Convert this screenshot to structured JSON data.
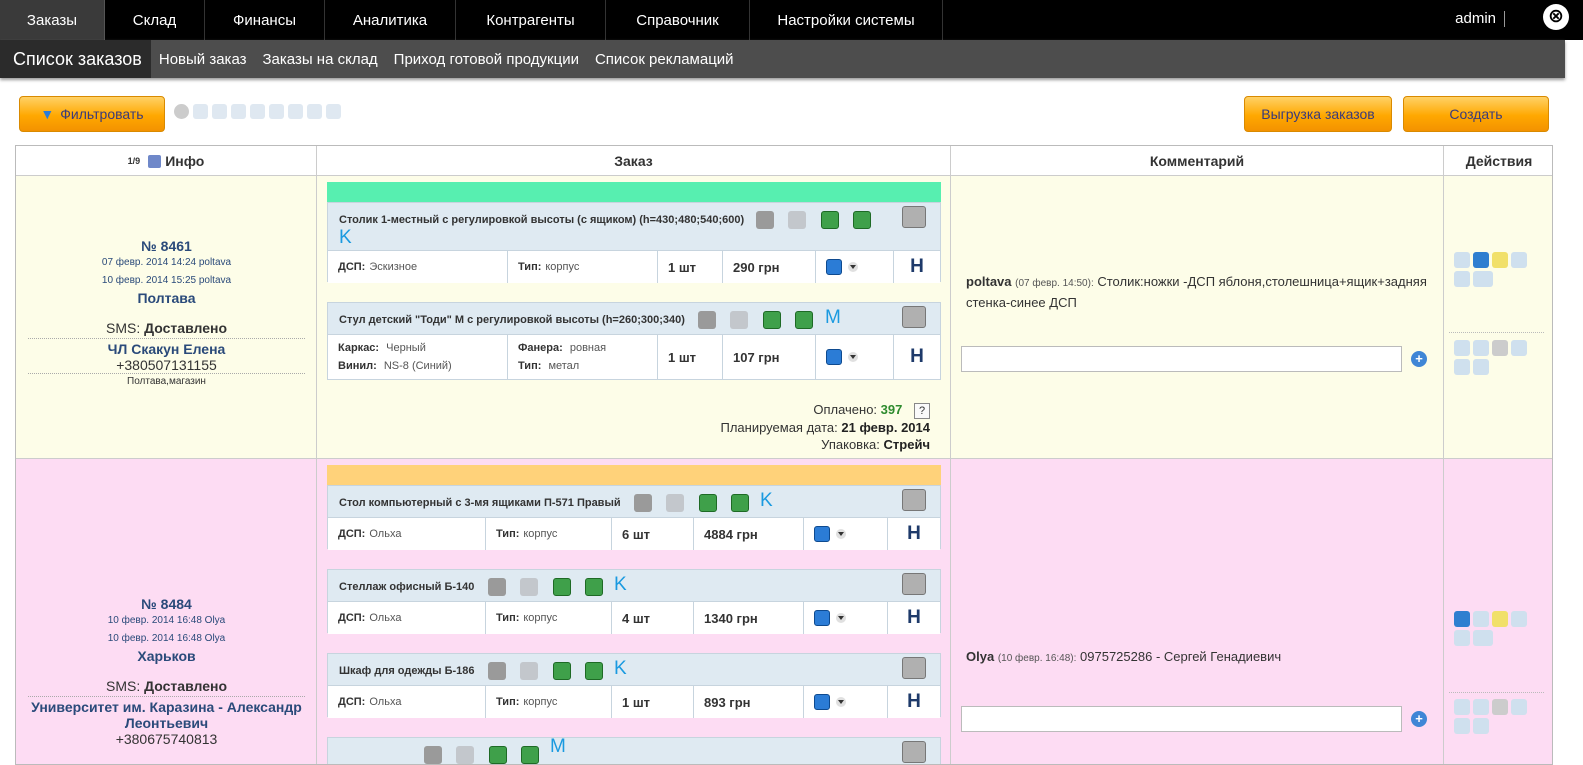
{
  "topnav": {
    "items": [
      "Заказы",
      "Склад",
      "Финансы",
      "Аналитика",
      "Контрагенты",
      "Справочник",
      "Настройки системы"
    ],
    "user": "admin",
    "close_icon": "⊗"
  },
  "subnav": {
    "items": [
      "Список заказов",
      "Новый заказ",
      "Заказы на склад",
      "Приход готовой продукции",
      "Список рекламаций"
    ]
  },
  "toolbar": {
    "filter_label": "Фильтровать",
    "export_label": "Выгрузка заказов",
    "create_label": "Создать"
  },
  "table": {
    "headers": {
      "info": "Инфо",
      "order": "Заказ",
      "comment": "Комментарий",
      "actions": "Действия"
    },
    "sort_icon_label": "1/9"
  },
  "orders": [
    {
      "number": "№ 8461",
      "created": "07 февр. 2014 14:24 poltava",
      "updated": "10 февр. 2014 15:25 poltava",
      "city": "Полтава",
      "sms_label": "SMS:",
      "sms_status": "Доставлено",
      "customer": "ЧЛ Скакун Елена",
      "phone": "+380507131155",
      "note": "Полтава,магазин",
      "status_color": "#57efb0",
      "row_color": "#fdfde8",
      "items": [
        {
          "title": "Столик 1-местный с регулировкой высоты (с ящиком) (h=430;480;540;600)",
          "letter": "K",
          "props": [
            {
              "k": "ДСП:",
              "v": "Эскизное"
            },
            {
              "k": "Тип:",
              "v": "корпус"
            }
          ],
          "qty": "1 шт",
          "price": "290 грн",
          "h": "Н"
        },
        {
          "title": "Стул детский \"Тоди\" М с регулировкой высоты (h=260;300;340)",
          "letter": "M",
          "props": [
            {
              "k": "Каркас:",
              "v": "Черный"
            },
            {
              "k": "Винил:",
              "v": "NS-8 (Синий)"
            },
            {
              "k": "Фанера:",
              "v": "ровная"
            },
            {
              "k": "Тип:",
              "v": "метал"
            }
          ],
          "qty": "1 шт",
          "price": "107 грн",
          "h": "Н"
        }
      ],
      "paid_label": "Оплачено:",
      "paid_value": "397",
      "paid_help": "?",
      "planned_label": "Планируемая дата:",
      "planned_value": "21 февр. 2014",
      "pack_label": "Упаковка:",
      "pack_value": "Стрейч",
      "comment_author": "poltava",
      "comment_time": "(07 февр. 14:50):",
      "comment_text": "Столик:ножки -ДСП яблоня,столешница+ящик+задняя стенка-синее ДСП"
    },
    {
      "number": "№ 8484",
      "created": "10 февр. 2014 16:48 Olya",
      "updated": "10 февр. 2014 16:48 Olya",
      "city": "Харьков",
      "sms_label": "SMS:",
      "sms_status": "Доставлено",
      "customer": "Университет им. Каразина - Александр Леонтьевич",
      "phone": "+380675740813",
      "status_color": "#ffd27a",
      "row_color": "#fddcf3",
      "items": [
        {
          "title": "Стол компьютерный с 3-мя ящиками П-571 Правый",
          "letter": "K",
          "props": [
            {
              "k": "ДСП:",
              "v": "Ольха"
            },
            {
              "k": "Тип:",
              "v": "корпус"
            }
          ],
          "qty": "6 шт",
          "price": "4884 грн",
          "h": "Н"
        },
        {
          "title": "Стеллаж офисный Б-140",
          "letter": "K",
          "props": [
            {
              "k": "ДСП:",
              "v": "Ольха"
            },
            {
              "k": "Тип:",
              "v": "корпус"
            }
          ],
          "qty": "4 шт",
          "price": "1340 грн",
          "h": "Н"
        },
        {
          "title": "Шкаф для одежды Б-186",
          "letter": "K",
          "props": [
            {
              "k": "ДСП:",
              "v": "Ольха"
            },
            {
              "k": "Тип:",
              "v": "корпус"
            }
          ],
          "qty": "1 шт",
          "price": "893 грн",
          "h": "Н"
        },
        {
          "letter": "M"
        }
      ],
      "comment_author": "Olya",
      "comment_time": "(10 февр. 16:48):",
      "comment_text": "0975725286 - Сергей Генадиевич"
    }
  ]
}
